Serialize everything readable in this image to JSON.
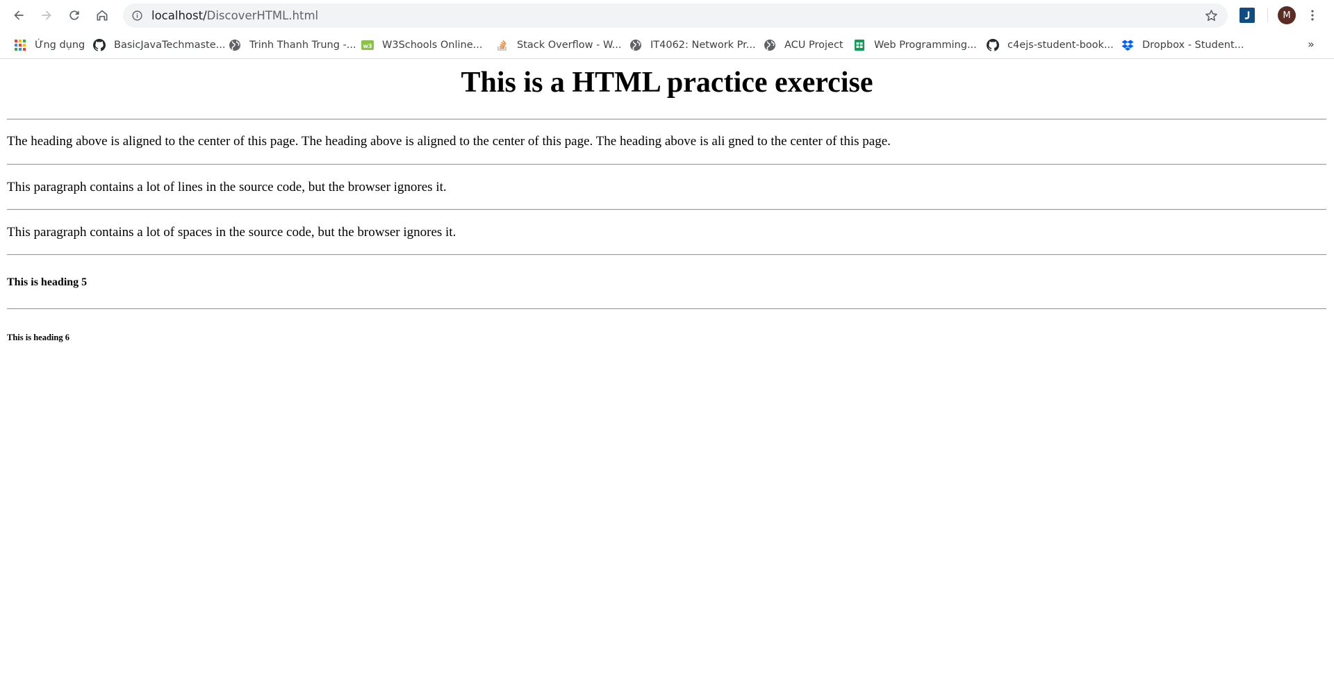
{
  "browser": {
    "url_host": "localhost/",
    "url_path": "DiscoverHTML.html",
    "avatar_initial": "M",
    "bookmarks": [
      {
        "label": "Ứng dụng",
        "icon": "apps-grid-icon"
      },
      {
        "label": "BasicJavaTechmaste...",
        "icon": "github-icon"
      },
      {
        "label": "Trinh Thanh Trung -...",
        "icon": "globe-icon"
      },
      {
        "label": "W3Schools Online...",
        "icon": "w3schools-icon"
      },
      {
        "label": "Stack Overflow - W...",
        "icon": "stackoverflow-icon"
      },
      {
        "label": "IT4062: Network Pr...",
        "icon": "globe-icon"
      },
      {
        "label": "ACU Project",
        "icon": "globe-icon"
      },
      {
        "label": "Web Programming...",
        "icon": "google-sheets-icon"
      },
      {
        "label": "c4ejs-student-book...",
        "icon": "github-icon"
      },
      {
        "label": "Dropbox - Student...",
        "icon": "dropbox-icon"
      }
    ],
    "bookmarks_overflow": "»"
  },
  "content": {
    "heading": "This is a HTML practice exercise",
    "paragraph_1": "The heading above is aligned to the center of this page. The heading above is aligned to the center of this page. The heading above is ali gned to the center of this page.",
    "paragraph_2": "This paragraph contains a lot of lines in the source code, but the browser ignores it.",
    "paragraph_3": "This paragraph contains a lot of spaces in the source code, but the browser ignores it.",
    "heading_5": "This is heading 5",
    "heading_6": "This is heading 6"
  },
  "colors": {
    "omnibox_bg": "#f1f3f4",
    "avatar_bg": "#5b2c24",
    "hr": "#9a9a9a"
  }
}
